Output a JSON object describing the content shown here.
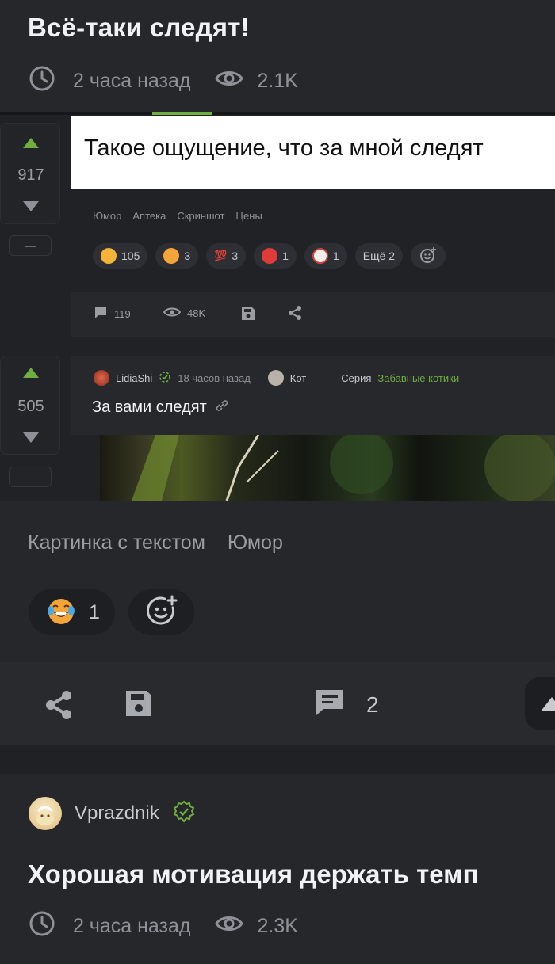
{
  "post1": {
    "title": "Всё-таки следят!",
    "time": "2 часа назад",
    "views": "2.1K"
  },
  "embed": {
    "post_a": {
      "rating": "917",
      "image_text": "Такое ощущение, что за мной следят",
      "tags": [
        "Юмор",
        "Аптека",
        "Скриншот",
        "Цены"
      ],
      "reactions": [
        {
          "icon": "laugh-tears-emoji-icon",
          "count": "105"
        },
        {
          "icon": "grin-emoji-icon",
          "count": "3"
        },
        {
          "icon": "hundred-emoji-icon",
          "count": "3"
        },
        {
          "icon": "angry-emoji-icon",
          "count": "1"
        },
        {
          "icon": "clown-emoji-icon",
          "count": "1"
        }
      ],
      "more_reactions": "Ещё 2",
      "comments": "119",
      "views": "48K"
    },
    "post_b": {
      "rating": "505",
      "author": "LidiaShi",
      "time": "18 часов назад",
      "community": "Кот",
      "series_label": "Серия",
      "series_name": "Забавные котики",
      "title": "За вами следят"
    }
  },
  "tags": [
    "Картинка с текстом",
    "Юмор"
  ],
  "reactions": [
    {
      "icon": "laugh-tears-emoji-icon",
      "count": "1"
    }
  ],
  "footer": {
    "comments": "2"
  },
  "post2": {
    "author": "Vprazdnik",
    "title": "Хорошая мотивация держать темп",
    "time": "2 часа назад",
    "views": "2.3K"
  },
  "colors": {
    "background": "#25272b",
    "accent_green": "#6fae3f",
    "muted_text": "#8e9298"
  }
}
